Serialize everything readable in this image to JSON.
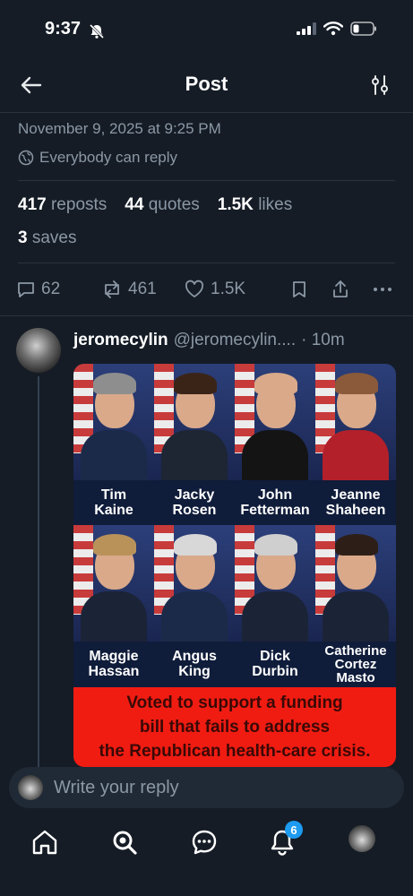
{
  "status_bar": {
    "time": "9:37"
  },
  "header": {
    "title": "Post"
  },
  "meta": {
    "date": "November 9, 2025 at 9:25 PM",
    "reply_setting": "Everybody can reply"
  },
  "stats": {
    "reposts_count": "417",
    "reposts_label": "reposts",
    "quotes_count": "44",
    "quotes_label": "quotes",
    "likes_count": "1.5K",
    "likes_label": "likes",
    "saves_count": "3",
    "saves_label": "saves"
  },
  "actions": {
    "replies": "62",
    "reposts": "461",
    "likes": "1.5K"
  },
  "reply": {
    "name": "jeromecylin",
    "handle": "@jeromecylin....",
    "time": "· 10m",
    "image": {
      "people": [
        {
          "first": "Tim",
          "last": "Kaine",
          "hair": "#8e8e8e",
          "suit": "#1b2a48"
        },
        {
          "first": "Jacky",
          "last": "Rosen",
          "hair": "#3a2418",
          "suit": "#1e2533"
        },
        {
          "first": "John",
          "last": "Fetterman",
          "hair": "#d9a98a",
          "suit": "#141414"
        },
        {
          "first": "Jeanne",
          "last": "Shaheen",
          "hair": "#8a5a3a",
          "suit": "#b3202a"
        },
        {
          "first": "Maggie",
          "last": "Hassan",
          "hair": "#b9925a",
          "suit": "#1b2336"
        },
        {
          "first": "Angus",
          "last": "King",
          "hair": "#d8d8d8",
          "suit": "#1b2a48"
        },
        {
          "first": "Dick",
          "last": "Durbin",
          "hair": "#cfcfcf",
          "suit": "#1b2336"
        },
        {
          "first": "Catherine",
          "last": "Cortez Masto",
          "hair": "#2d1f18",
          "suit": "#1b2336"
        }
      ],
      "banner_lines": [
        "Voted to support a funding",
        "bill that fails to address",
        "the Republican health-care crisis."
      ]
    }
  },
  "composer": {
    "placeholder": "Write your reply"
  },
  "tabbar": {
    "notifications_badge": "6"
  }
}
